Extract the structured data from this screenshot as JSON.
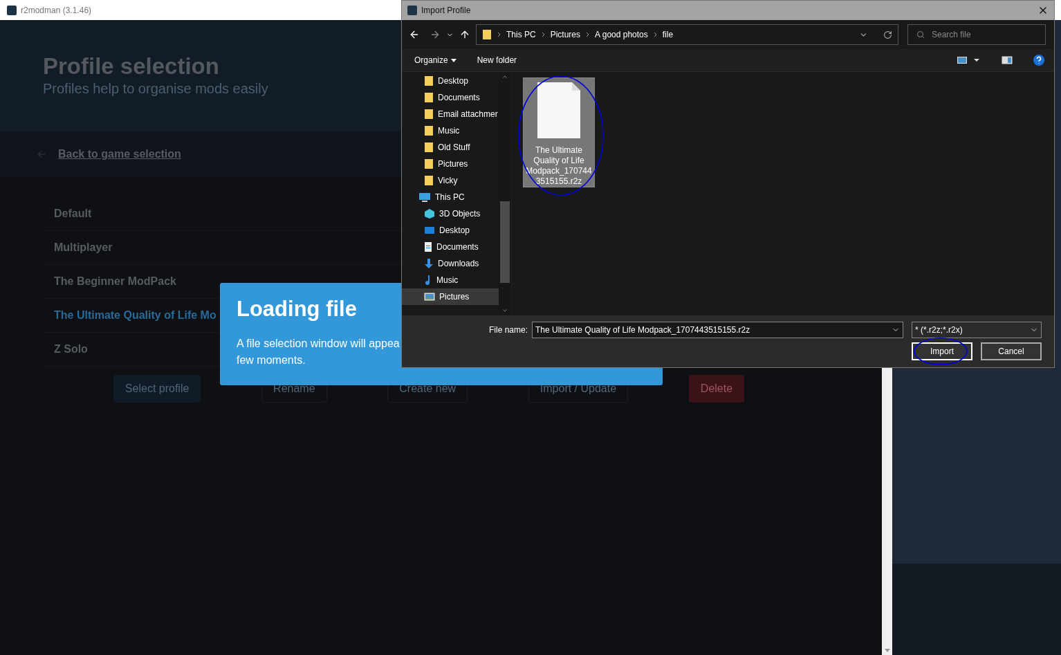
{
  "app": {
    "title": "r2modman (3.1.46)",
    "heading": "Profile selection",
    "subheading": "Profiles help to organise mods easily",
    "back_link": "Back to game selection",
    "profiles": [
      {
        "name": "Default",
        "selected": false
      },
      {
        "name": "Multiplayer",
        "selected": false
      },
      {
        "name": "The Beginner ModPack",
        "selected": false
      },
      {
        "name": "The Ultimate Quality of Life Mo",
        "selected": true
      },
      {
        "name": "Z Solo",
        "selected": false
      }
    ],
    "actions": [
      {
        "label": "Select profile",
        "kind": "primary"
      },
      {
        "label": "Rename",
        "kind": "outline"
      },
      {
        "label": "Create new",
        "kind": "outline"
      },
      {
        "label": "Import / Update",
        "kind": "outline"
      },
      {
        "label": "Delete",
        "kind": "danger"
      }
    ]
  },
  "loading_modal": {
    "title": "Loading file",
    "lines": [
      "A file selection window will appea",
      "few moments."
    ]
  },
  "dialog": {
    "title": "Import Profile",
    "breadcrumb": [
      "This PC",
      "Pictures",
      "A good photos",
      "file"
    ],
    "search_placeholder": "Search file",
    "organize": "Organize",
    "new_folder": "New folder",
    "nav": [
      {
        "label": "Desktop",
        "kind": "folder",
        "selected": false
      },
      {
        "label": "Documents",
        "kind": "folder",
        "selected": false
      },
      {
        "label": "Email attachmer",
        "kind": "folder",
        "selected": false
      },
      {
        "label": "Music",
        "kind": "folder",
        "selected": false
      },
      {
        "label": "Old Stuff",
        "kind": "folder",
        "selected": false
      },
      {
        "label": "Pictures",
        "kind": "folder",
        "selected": false
      },
      {
        "label": "Vicky",
        "kind": "folder",
        "selected": false
      },
      {
        "label": "This PC",
        "kind": "pc",
        "selected": false,
        "children": [
          {
            "label": "3D Objects",
            "kind": "cube",
            "selected": false
          },
          {
            "label": "Desktop",
            "kind": "desktop",
            "selected": false
          },
          {
            "label": "Documents",
            "kind": "document",
            "selected": false
          },
          {
            "label": "Downloads",
            "kind": "download",
            "selected": false
          },
          {
            "label": "Music",
            "kind": "music",
            "selected": false
          },
          {
            "label": "Pictures",
            "kind": "pictures",
            "selected": true
          }
        ]
      }
    ],
    "files": [
      {
        "lines": [
          "The Ultimate",
          "Quality of Life",
          "Modpack_170744",
          "3515155.r2z"
        ],
        "selected": true
      }
    ],
    "file_name_label": "File name:",
    "file_name": "The Ultimate Quality of Life Modpack_1707443515155.r2z",
    "filter": "* (*.r2z;*.r2x)",
    "buttons": [
      {
        "label": "Import",
        "kind": "default"
      },
      {
        "label": "Cancel",
        "kind": "normal"
      }
    ]
  }
}
